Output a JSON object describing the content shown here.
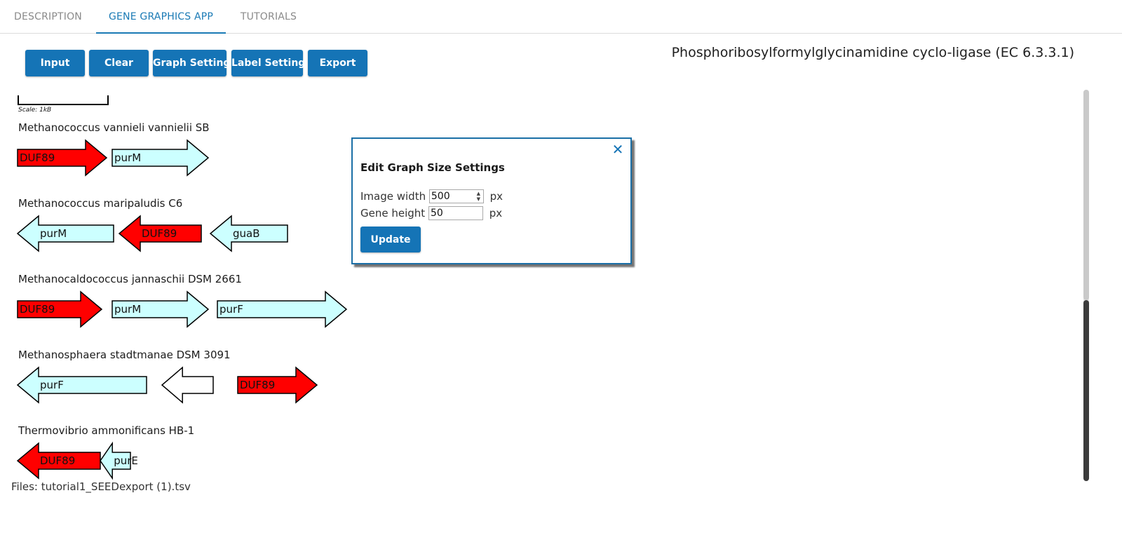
{
  "tabs": [
    {
      "label": "DESCRIPTION",
      "active": false
    },
    {
      "label": "GENE GRAPHICS APP",
      "active": true
    },
    {
      "label": "TUTORIALS",
      "active": false
    }
  ],
  "toolbar": {
    "input_label": "Input",
    "clear_label": "Clear",
    "graph_settings_label": "Graph Settings",
    "label_settings_label": "Label Settings",
    "export_label": "Export"
  },
  "enzyme_title": "Phosphoribosylformylglycinamidine cyclo-ligase (EC 6.3.3.1)",
  "scale": {
    "label": "Scale: 1kB"
  },
  "colors": {
    "accent": "#1574b6",
    "focal_gene": "#ff0000",
    "other_gene": "#ccffff",
    "unlabeled_gene": "#ffffff"
  },
  "genomes": [
    {
      "species": "Methanococcus vannieli vannielii SB",
      "genes": [
        {
          "label": "DUF89",
          "strand": "+",
          "type": "focal"
        },
        {
          "label": "purM",
          "strand": "+",
          "type": "other"
        }
      ]
    },
    {
      "species": "Methanococcus maripaludis C6",
      "genes": [
        {
          "label": "purM",
          "strand": "-",
          "type": "other"
        },
        {
          "label": "DUF89",
          "strand": "-",
          "type": "focal"
        },
        {
          "label": "guaB",
          "strand": "-",
          "type": "other"
        }
      ]
    },
    {
      "species": "Methanocaldococcus jannaschii DSM 2661",
      "genes": [
        {
          "label": "DUF89",
          "strand": "+",
          "type": "focal"
        },
        {
          "label": "purM",
          "strand": "+",
          "type": "other"
        },
        {
          "label": "purF",
          "strand": "+",
          "type": "other"
        }
      ]
    },
    {
      "species": "Methanosphaera stadtmanae DSM 3091",
      "genes": [
        {
          "label": "purF",
          "strand": "-",
          "type": "other"
        },
        {
          "label": "",
          "strand": "-",
          "type": "unlabeled"
        },
        {
          "label": "DUF89",
          "strand": "+",
          "type": "focal"
        }
      ]
    },
    {
      "species": "Thermovibrio ammonificans HB-1",
      "genes": [
        {
          "label": "DUF89",
          "strand": "-",
          "type": "focal"
        },
        {
          "label": "purE",
          "strand": "-",
          "type": "other"
        }
      ]
    }
  ],
  "files_label": "Files: tutorial1_SEEDexport (1).tsv",
  "dialog": {
    "title": "Edit Graph Size Settings",
    "close_icon": "close-icon",
    "image_width_label": "Image width",
    "image_width_value": "500",
    "gene_height_label": "Gene height",
    "gene_height_value": "50",
    "unit": "px",
    "update_label": "Update"
  }
}
